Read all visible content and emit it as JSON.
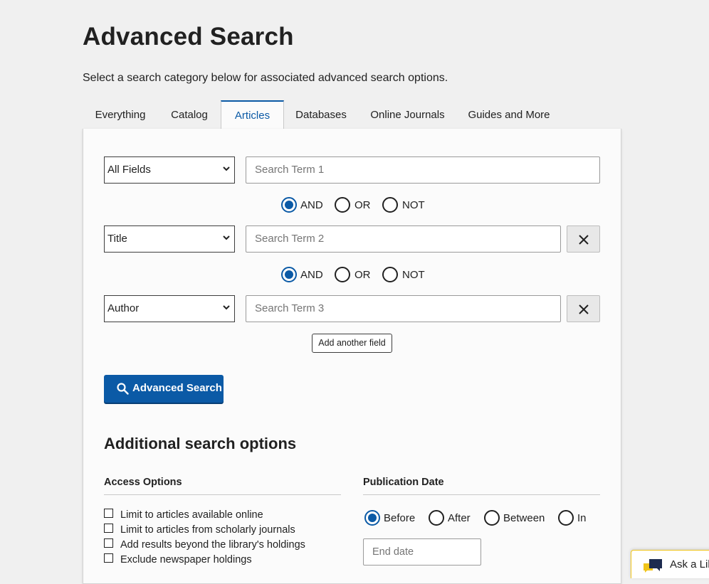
{
  "page": {
    "title": "Advanced Search",
    "intro": "Select a search category below for associated advanced search options."
  },
  "tabs": [
    {
      "label": "Everything",
      "active": false
    },
    {
      "label": "Catalog",
      "active": false
    },
    {
      "label": "Articles",
      "active": true
    },
    {
      "label": "Databases",
      "active": false
    },
    {
      "label": "Online Journals",
      "active": false
    },
    {
      "label": "Guides and More",
      "active": false
    }
  ],
  "rows": [
    {
      "field": "All Fields",
      "placeholder": "Search Term 1",
      "removable": false
    },
    {
      "field": "Title",
      "placeholder": "Search Term 2",
      "removable": true
    },
    {
      "field": "Author",
      "placeholder": "Search Term 3",
      "removable": true
    }
  ],
  "booleans": [
    {
      "options": [
        "AND",
        "OR",
        "NOT"
      ],
      "selected": "AND"
    },
    {
      "options": [
        "AND",
        "OR",
        "NOT"
      ],
      "selected": "AND"
    }
  ],
  "buttons": {
    "add_field": "Add another field",
    "advanced_search": "Advanced Search"
  },
  "additional": {
    "title": "Additional search options",
    "access": {
      "heading": "Access Options",
      "options": [
        {
          "label": "Limit to articles available online",
          "checked": false
        },
        {
          "label": "Limit to articles from scholarly journals",
          "checked": false
        },
        {
          "label": "Add results beyond the library's holdings",
          "checked": false
        },
        {
          "label": "Exclude newspaper holdings",
          "checked": false
        }
      ]
    },
    "publication_date": {
      "heading": "Publication Date",
      "options": [
        "Before",
        "After",
        "Between",
        "In"
      ],
      "selected": "Before",
      "end_date_placeholder": "End date"
    }
  },
  "ask_widget": {
    "label": "Ask a Lib"
  },
  "colors": {
    "accent": "#0b5aa6",
    "page_bg": "#f0f0f0",
    "ask_border": "#f0c419"
  }
}
